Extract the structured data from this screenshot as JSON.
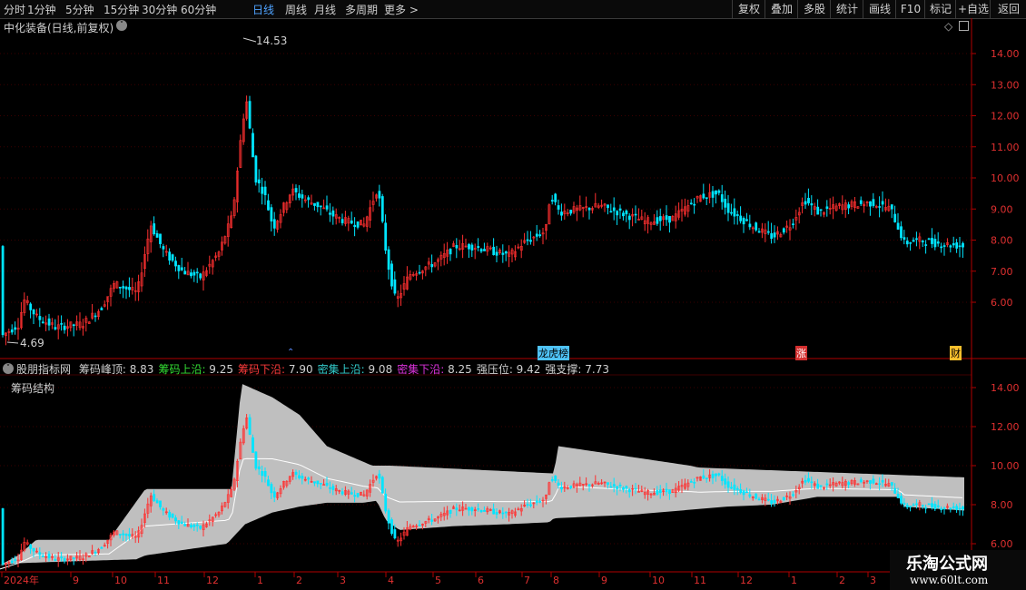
{
  "toolbar": {
    "periods": [
      "分时",
      "1分钟",
      "5分钟",
      "15分钟",
      "30分钟",
      "60分钟",
      "日线",
      "周线",
      "月线",
      "多周期",
      "更多 >"
    ],
    "active_period": "日线",
    "right_buttons": [
      "复权",
      "叠加",
      "多股",
      "统计",
      "画线",
      "F10",
      "标记",
      "+自选",
      "返回"
    ]
  },
  "main_chart": {
    "title": "中化装备(日线,前复权)",
    "high_label": "14.53",
    "low_label": "4.69",
    "y_ticks": [
      "14.00",
      "13.00",
      "12.00",
      "11.00",
      "10.00",
      "9.00",
      "8.00",
      "7.00",
      "6.00"
    ],
    "markers": [
      "龙虎榜",
      "涨",
      "财"
    ]
  },
  "indicator": {
    "source": "股朋指标网",
    "items": [
      {
        "label": "筹码峰顶",
        "value": "8.83",
        "color": "#d0d0d0"
      },
      {
        "label": "筹码上沿",
        "value": "9.25",
        "color": "#33dd33"
      },
      {
        "label": "筹码下沿",
        "value": "7.90",
        "color": "#ff3b3b"
      },
      {
        "label": "密集上沿",
        "value": "9.08",
        "color": "#33cccc"
      },
      {
        "label": "密集下沿",
        "value": "8.25",
        "color": "#dd33dd"
      },
      {
        "label": "强压位",
        "value": "9.42",
        "color": "#d0d0d0"
      },
      {
        "label": "强支撑",
        "value": "7.73",
        "color": "#d0d0d0"
      }
    ],
    "panel_title": "筹码结构",
    "y_ticks": [
      "14.00",
      "12.00",
      "10.00",
      "8.00",
      "6.00"
    ]
  },
  "x_axis": [
    "2024年",
    "9",
    "10",
    "11",
    "12",
    "1",
    "2",
    "3",
    "4",
    "5",
    "6",
    "7",
    "8",
    "9",
    "10",
    "11",
    "12",
    "1",
    "2",
    "3"
  ],
  "watermark": {
    "line1": "乐淘公式网",
    "line2": "www.60lt.com"
  },
  "chart_data": {
    "type": "candlestick",
    "title": "中化装备(日线,前复权)",
    "y_range": [
      4.5,
      14.8
    ],
    "high": 14.53,
    "low": 4.69,
    "close_path": [
      [
        "2024年",
        5.0
      ],
      [
        "9",
        5.2
      ],
      [
        "10",
        6.5
      ],
      [
        "11",
        7.5
      ],
      [
        "12",
        7.8
      ],
      [
        "1",
        9.5
      ],
      [
        "2",
        8.8
      ],
      [
        "3",
        8.4
      ],
      [
        "4",
        6.8
      ],
      [
        "5",
        7.7
      ],
      [
        "6",
        7.6
      ],
      [
        "7",
        8.2
      ],
      [
        "8",
        8.9
      ],
      [
        "9",
        9.0
      ],
      [
        "10",
        8.6
      ],
      [
        "11",
        9.6
      ],
      [
        "12",
        8.3
      ],
      [
        "1",
        8.9
      ],
      [
        "2",
        9.2
      ],
      [
        "3",
        8.0
      ]
    ],
    "indicator": {
      "series": [
        {
          "name": "筹码上沿",
          "value": 9.25
        },
        {
          "name": "筹码下沿",
          "value": 7.9
        }
      ]
    }
  }
}
